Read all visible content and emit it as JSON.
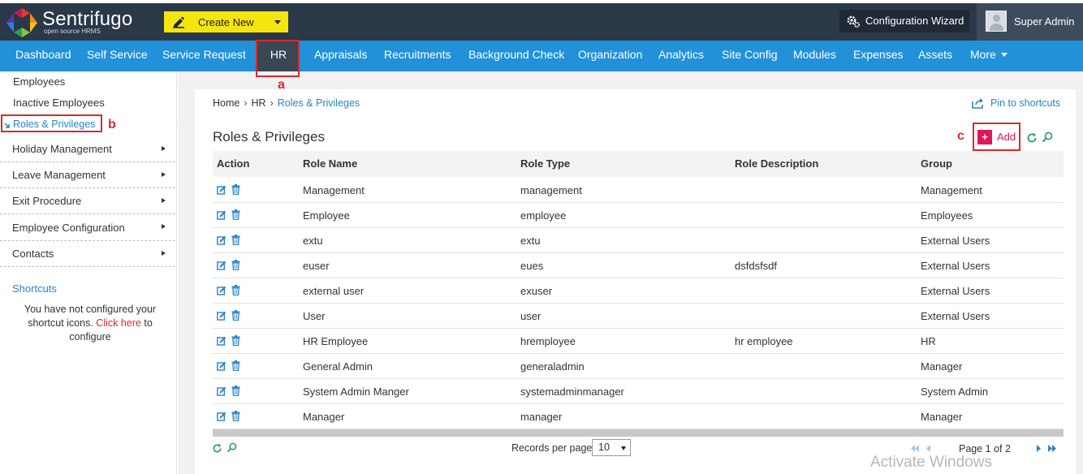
{
  "app": {
    "name": "Sentrifugo",
    "tagline": "open source HRMS"
  },
  "header": {
    "create_new_label": "Create New",
    "config_wizard_label": "Configuration Wizard",
    "user_name": "Super Admin"
  },
  "nav": {
    "items": [
      {
        "label": "Dashboard"
      },
      {
        "label": "Self Service"
      },
      {
        "label": "Service Request"
      },
      {
        "label": "HR",
        "active": true
      },
      {
        "label": "Appraisals"
      },
      {
        "label": "Recruitments"
      },
      {
        "label": "Background Check"
      },
      {
        "label": "Organization"
      },
      {
        "label": "Analytics"
      },
      {
        "label": "Site Config"
      },
      {
        "label": "Modules"
      },
      {
        "label": "Expenses"
      },
      {
        "label": "Assets"
      },
      {
        "label": "More"
      }
    ]
  },
  "annotations": {
    "a": "a",
    "b": "b",
    "c": "c"
  },
  "sidebar": {
    "links": [
      "Employees",
      "Inactive Employees"
    ],
    "active_link": "Roles & Privileges",
    "menus": [
      "Holiday Management",
      "Leave Management",
      "Exit Procedure",
      "Employee Configuration",
      "Contacts"
    ],
    "shortcuts_title": "Shortcuts",
    "shortcuts_msg_before": "You have not configured your shortcut icons. ",
    "shortcuts_click": "Click here",
    "shortcuts_msg_after": " to configure"
  },
  "breadcrumb": {
    "home": "Home",
    "section": "HR",
    "current": "Roles & Privileges",
    "separator": "›"
  },
  "pin_label": "Pin to shortcuts",
  "page_title": "Roles & Privileges",
  "add_label": "Add",
  "table": {
    "columns": [
      "Action",
      "Role Name",
      "Role Type",
      "Role Description",
      "Group"
    ],
    "rows": [
      {
        "name": "Management",
        "type": "management",
        "description": "",
        "group": "Management"
      },
      {
        "name": "Employee",
        "type": "employee",
        "description": "",
        "group": "Employees"
      },
      {
        "name": "extu",
        "type": "extu",
        "description": "",
        "group": "External Users"
      },
      {
        "name": "euser",
        "type": "eues",
        "description": "dsfdsfsdf",
        "group": "External Users"
      },
      {
        "name": "external user",
        "type": "exuser",
        "description": "",
        "group": "External Users"
      },
      {
        "name": "User",
        "type": "user",
        "description": "",
        "group": "External Users"
      },
      {
        "name": "HR Employee",
        "type": "hremployee",
        "description": "hr employee",
        "group": "HR"
      },
      {
        "name": "General Admin",
        "type": "generaladmin",
        "description": "",
        "group": "Manager"
      },
      {
        "name": "System Admin Manger",
        "type": "systemadminmanager",
        "description": "",
        "group": "System Admin"
      },
      {
        "name": "Manager",
        "type": "manager",
        "description": "",
        "group": "Manager"
      }
    ]
  },
  "pagination": {
    "records_per_page_label": "Records per page",
    "records_per_page_value": "10",
    "page_info": "Page 1 of 2"
  },
  "watermark": "Activate Windows",
  "colors": {
    "header_bg": "#2a3848",
    "nav_bg": "#2391d9",
    "nav_active_bg": "#3b4655",
    "create_btn": "#f5e50f",
    "accent_link": "#2a84c6",
    "add_accent": "#e0165a",
    "annotation_red": "#d62b2b"
  },
  "icons": {
    "create": "pencil-icon",
    "wizard": "gear-icon",
    "pin": "export-icon",
    "refresh": "refresh-icon",
    "search": "search-icon",
    "edit": "edit-icon",
    "delete": "trash-icon"
  }
}
